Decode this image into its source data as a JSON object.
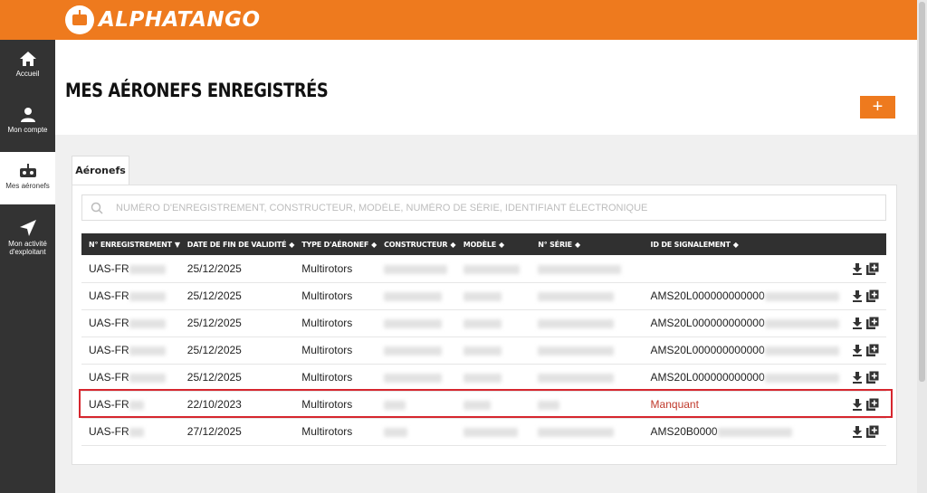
{
  "app": {
    "name": "ALPHATANGO",
    "accent": "#ee7a1e"
  },
  "sidebar": {
    "items": [
      {
        "label": "Accueil",
        "icon": "home-icon"
      },
      {
        "label": "Mon compte",
        "icon": "user-icon"
      },
      {
        "label": "Mes aéronefs",
        "icon": "drone-icon",
        "active": true
      },
      {
        "label": "Mon activité d'exploitant",
        "icon": "send-icon"
      }
    ]
  },
  "page": {
    "title": "MES AÉRONEFS ENREGISTRÉS",
    "add_label": "+"
  },
  "tabs": [
    {
      "label": "Aéronefs"
    }
  ],
  "search": {
    "placeholder": "NUMÉRO D'ENREGISTREMENT, CONSTRUCTEUR, MODÈLE, NUMÉRO DE SÉRIE, IDENTIFIANT ÉLECTRONIQUE"
  },
  "table": {
    "columns": [
      {
        "label": "N° ENREGISTREMENT",
        "sort": "▼"
      },
      {
        "label": "DATE DE FIN DE VALIDITÉ",
        "sort": "◆"
      },
      {
        "label": "TYPE D'AÉRONEF",
        "sort": "◆"
      },
      {
        "label": "CONSTRUCTEUR",
        "sort": "◆"
      },
      {
        "label": "MODÈLE",
        "sort": "◆"
      },
      {
        "label": "N° SÉRIE",
        "sort": "◆"
      },
      {
        "label": "ID DE SIGNALEMENT",
        "sort": "◆"
      }
    ],
    "rows": [
      {
        "reg": "UAS-FR",
        "date": "25/12/2025",
        "type": "Multirotors",
        "id": ""
      },
      {
        "reg": "UAS-FR",
        "date": "25/12/2025",
        "type": "Multirotors",
        "id": "AMS20L000000000000"
      },
      {
        "reg": "UAS-FR",
        "date": "25/12/2025",
        "type": "Multirotors",
        "id": "AMS20L000000000000"
      },
      {
        "reg": "UAS-FR",
        "date": "25/12/2025",
        "type": "Multirotors",
        "id": "AMS20L000000000000"
      },
      {
        "reg": "UAS-FR",
        "date": "25/12/2025",
        "type": "Multirotors",
        "id": "AMS20L000000000000"
      },
      {
        "reg": "UAS-FR",
        "date": "22/10/2023",
        "type": "Multirotors",
        "id": "Manquant",
        "missing": true,
        "highlighted": true
      },
      {
        "reg": "UAS-FR",
        "date": "27/12/2025",
        "type": "Multirotors",
        "id": "AMS20B0000"
      }
    ]
  }
}
